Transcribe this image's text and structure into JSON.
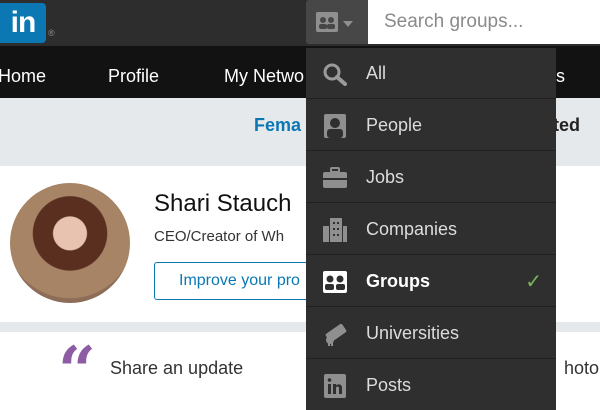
{
  "header": {
    "logo": "in",
    "logo_mark": "®",
    "search_type_icon": "groups-icon",
    "search_placeholder": "Search groups..."
  },
  "nav": {
    "items": [
      {
        "label": "Home"
      },
      {
        "label": "Profile"
      },
      {
        "label": "My Netwo"
      },
      {
        "label": "s"
      }
    ]
  },
  "banner": {
    "left_text": "Fema",
    "right_text": "vited"
  },
  "profile": {
    "name": "Shari Stauch",
    "title": "CEO/Creator of Wh",
    "improve_button": "Improve your pro"
  },
  "share": {
    "quote_glyph": "“",
    "label": "Share an update",
    "right_text": "hoto"
  },
  "search_menu": {
    "selected": "Groups",
    "items": [
      {
        "label": "All",
        "icon": "search-icon"
      },
      {
        "label": "People",
        "icon": "person-icon"
      },
      {
        "label": "Jobs",
        "icon": "briefcase-icon"
      },
      {
        "label": "Companies",
        "icon": "building-icon"
      },
      {
        "label": "Groups",
        "icon": "groups-icon"
      },
      {
        "label": "Universities",
        "icon": "diploma-icon"
      },
      {
        "label": "Posts",
        "icon": "linkedin-icon"
      }
    ],
    "check_glyph": "✓",
    "accent_color": "#7ab55c"
  },
  "colors": {
    "brand": "#0b78b4",
    "topbar": "#2d2d2d",
    "navbar": "#121212",
    "menu_bg": "#2f2f2f"
  }
}
